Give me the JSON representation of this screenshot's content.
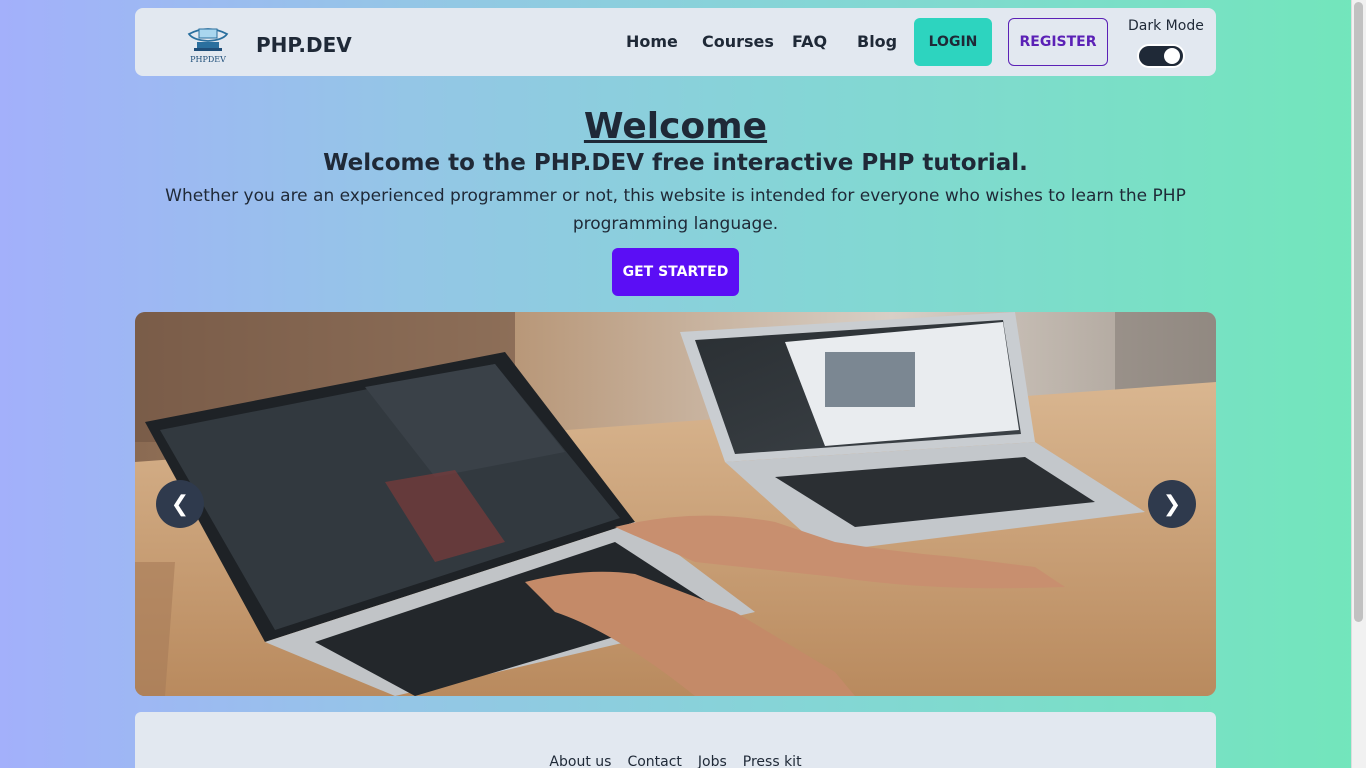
{
  "nav": {
    "brand": "PHP.DEV",
    "logo_text": "PHPDEV",
    "links": [
      "Home",
      "Courses",
      "FAQ",
      "Blog"
    ],
    "login": "LOGIN",
    "register": "REGISTER",
    "dark_mode_label": "Dark Mode"
  },
  "hero": {
    "title": "Welcome",
    "subtitle": "Welcome to the PHP.DEV free interactive PHP tutorial.",
    "text": "Whether you are an experienced programmer or not, this website is intended for everyone who wishes to learn the PHP programming language.",
    "cta": "GET STARTED"
  },
  "carousel": {
    "prev": "❮",
    "next": "❯"
  },
  "footer": {
    "links": [
      "About us",
      "Contact",
      "Jobs",
      "Press kit"
    ]
  },
  "colors": {
    "login_bg": "#2dd4bf",
    "register_border": "#5b21b6",
    "cta_bg": "#5b0ef5",
    "nav_bg": "#e2e8f0"
  }
}
